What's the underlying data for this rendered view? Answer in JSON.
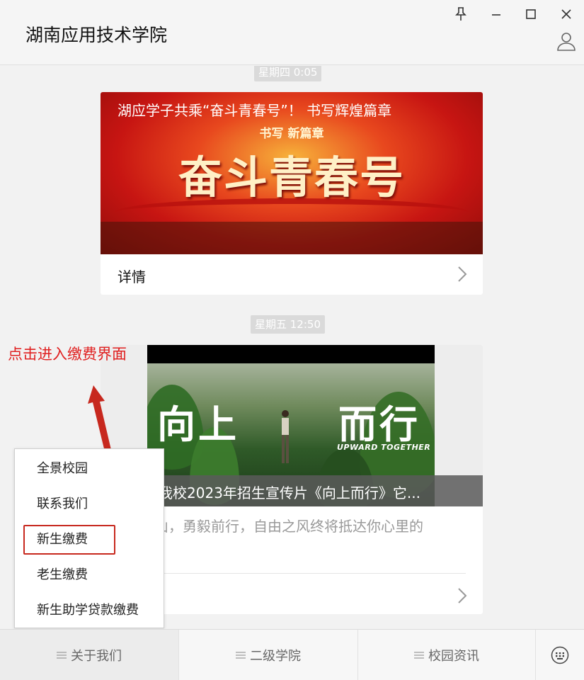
{
  "window": {
    "title": "湖南应用技术学院",
    "icons": {
      "pin": "pin-icon",
      "minimize": "minimize-icon",
      "maximize": "maximize-icon",
      "close": "close-icon",
      "profile": "user-profile-icon"
    }
  },
  "chat": {
    "messages": [
      {
        "timestamp": "星期四 0:05",
        "banner_small_title": "书写 新篇章",
        "banner_big_title": "奋斗青春号",
        "caption": "湖应学子共乘“奋斗青春号”！ 书写辉煌篇章",
        "detail_label": "详情"
      },
      {
        "timestamp": "星期五 12:50",
        "video_title_left": "向上",
        "video_title_right": "而行",
        "video_title_en": "UPWARD TOGETHER",
        "caption": "官宣发布!我校2023年招生宣传片《向上而行》它...",
        "description": "翻过这座山，勇毅前行，自由之风终将抵达你心里的"
      }
    ]
  },
  "annotation": {
    "text": "点击进入缴费界面",
    "color": "#e02020"
  },
  "menu": {
    "items": [
      "全景校园",
      "联系我们",
      "新生缴费",
      "老生缴费",
      "新生助学贷款缴费"
    ],
    "highlighted_index": 2,
    "highlight_color": "#c7281e"
  },
  "tabbar": {
    "tabs": [
      {
        "label": "关于我们",
        "icon": "menu-lines-icon"
      },
      {
        "label": "二级学院",
        "icon": "menu-lines-icon"
      },
      {
        "label": "校园资讯",
        "icon": "menu-lines-icon"
      }
    ],
    "keyboard_icon": "keyboard-icon"
  }
}
